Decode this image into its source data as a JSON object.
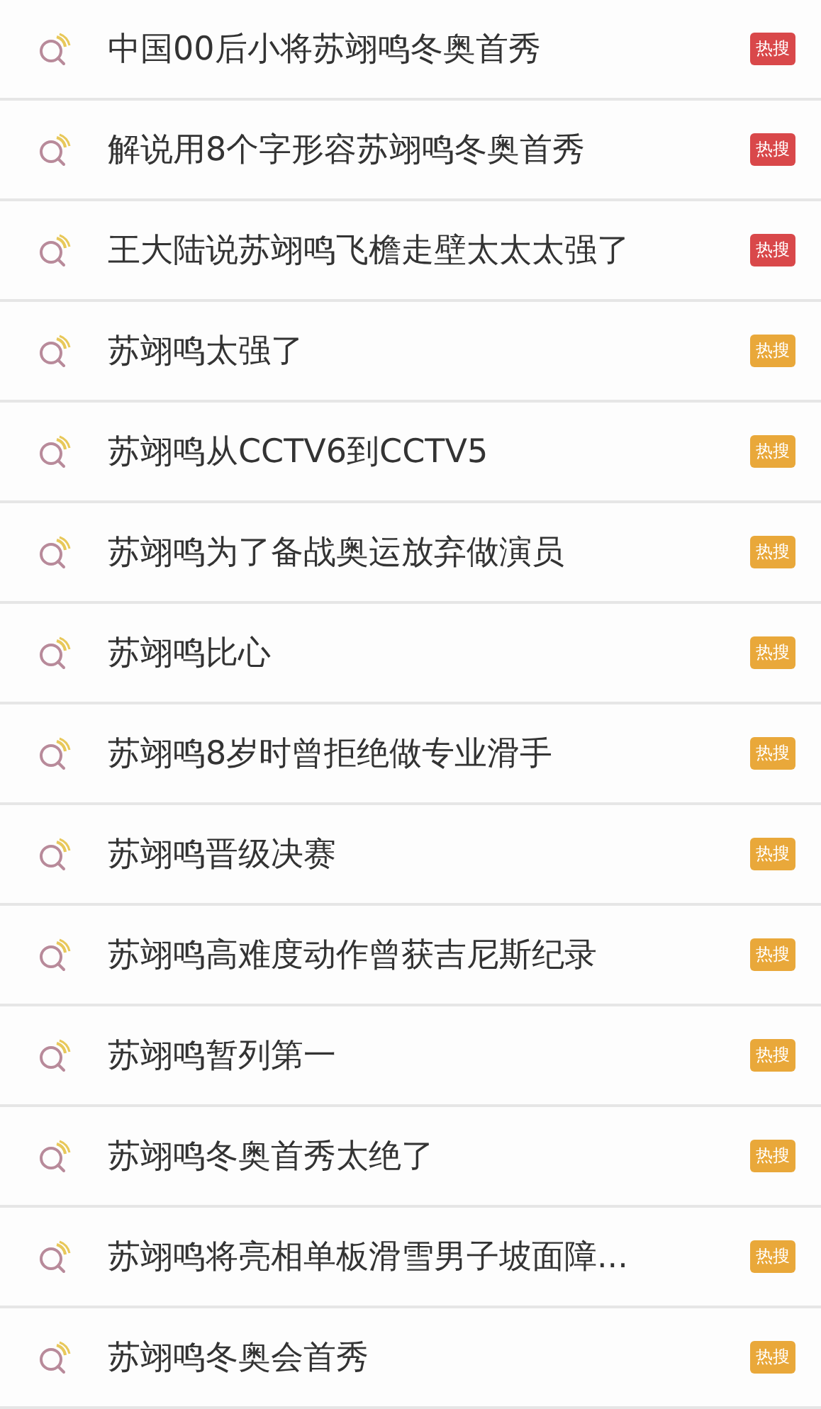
{
  "hot_searches": [
    {
      "title": "中国00后小将苏翊鸣冬奥首秀",
      "badge": {
        "label": "热搜",
        "color": "#d9484a"
      }
    },
    {
      "title": "解说用8个字形容苏翊鸣冬奥首秀",
      "badge": {
        "label": "热搜",
        "color": "#d9484a"
      }
    },
    {
      "title": "王大陆说苏翊鸣飞檐走壁太太太强了",
      "badge": {
        "label": "热搜",
        "color": "#d9484a"
      }
    },
    {
      "title": "苏翊鸣太强了",
      "badge": {
        "label": "热搜",
        "color": "#e9a83a"
      }
    },
    {
      "title": "苏翊鸣从CCTV6到CCTV5",
      "badge": {
        "label": "热搜",
        "color": "#e9a83a"
      }
    },
    {
      "title": "苏翊鸣为了备战奥运放弃做演员",
      "badge": {
        "label": "热搜",
        "color": "#e9a83a"
      }
    },
    {
      "title": "苏翊鸣比心",
      "badge": {
        "label": "热搜",
        "color": "#e9a83a"
      }
    },
    {
      "title": "苏翊鸣8岁时曾拒绝做专业滑手",
      "badge": {
        "label": "热搜",
        "color": "#e9a83a"
      }
    },
    {
      "title": "苏翊鸣晋级决赛",
      "badge": {
        "label": "热搜",
        "color": "#e9a83a"
      }
    },
    {
      "title": "苏翊鸣高难度动作曾获吉尼斯纪录",
      "badge": {
        "label": "热搜",
        "color": "#e9a83a"
      }
    },
    {
      "title": "苏翊鸣暂列第一",
      "badge": {
        "label": "热搜",
        "color": "#e9a83a"
      }
    },
    {
      "title": "苏翊鸣冬奥首秀太绝了",
      "badge": {
        "label": "热搜",
        "color": "#e9a83a"
      }
    },
    {
      "title": "苏翊鸣将亮相单板滑雪男子坡面障...",
      "badge": {
        "label": "热搜",
        "color": "#e9a83a"
      }
    },
    {
      "title": "苏翊鸣冬奥会首秀",
      "badge": {
        "label": "热搜",
        "color": "#e9a83a"
      }
    }
  ]
}
